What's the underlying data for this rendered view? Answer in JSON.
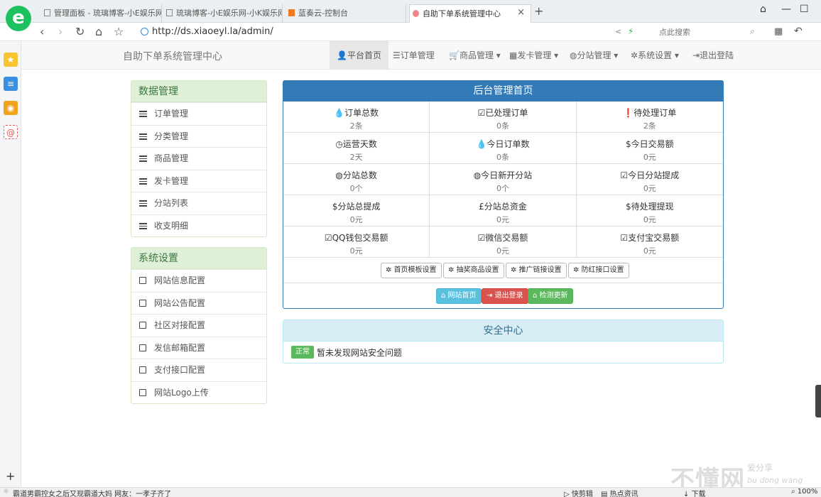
{
  "browser": {
    "tabs": [
      {
        "title": "管理面板 - 琉璃博客-小E娱乐网"
      },
      {
        "title": "琉璃博客-小E娱乐网-小K娱乐网"
      },
      {
        "title": "蓝奏云-控制台"
      },
      {
        "title": "自助下单系统管理中心"
      }
    ],
    "url": "http://ds.xiaoeyl.la/admin/",
    "search_placeholder": "点此搜索",
    "logo_letter": "e"
  },
  "nav": {
    "brand": "自助下单系统管理中心",
    "items": [
      {
        "label": "平台首页",
        "icon": "user-icon",
        "glyph": "👤"
      },
      {
        "label": "订单管理",
        "icon": "list-icon",
        "glyph": "☰"
      },
      {
        "label": "商品管理 ▾",
        "icon": "cart-icon",
        "glyph": "🛒"
      },
      {
        "label": "发卡管理 ▾",
        "icon": "grid-icon",
        "glyph": "▦"
      },
      {
        "label": "分站管理 ▾",
        "icon": "globe-icon",
        "glyph": "◍"
      },
      {
        "label": "系统设置 ▾",
        "icon": "gear-icon",
        "glyph": "✲"
      },
      {
        "label": "退出登陆",
        "icon": "logout-icon",
        "glyph": "⇥"
      }
    ]
  },
  "sidebar": {
    "data_title": "数据管理",
    "data_items": [
      "订单管理",
      "分类管理",
      "商品管理",
      "发卡管理",
      "分站列表",
      "收支明细"
    ],
    "system_title": "系统设置",
    "system_items": [
      "网站信息配置",
      "网站公告配置",
      "社区对接配置",
      "发信邮箱配置",
      "支付接口配置",
      "网站Logo上传"
    ]
  },
  "dashboard": {
    "title": "后台管理首页",
    "stats": [
      {
        "icon": "💧",
        "label": "订单总数",
        "value": "2条"
      },
      {
        "icon": "☑",
        "label": "已处理订单",
        "value": "0条"
      },
      {
        "icon": "❗",
        "label": "待处理订单",
        "value": "2条"
      },
      {
        "icon": "◷",
        "label": "运营天数",
        "value": "2天"
      },
      {
        "icon": "💧",
        "label": "今日订单数",
        "value": "0条"
      },
      {
        "icon": "$",
        "label": "今日交易额",
        "value": "0元"
      },
      {
        "icon": "◍",
        "label": "分站总数",
        "value": "0个"
      },
      {
        "icon": "◍",
        "label": "今日新开分站",
        "value": "0个"
      },
      {
        "icon": "☑",
        "label": "今日分站提成",
        "value": "0元"
      },
      {
        "icon": "$",
        "label": "分站总提成",
        "value": "0元"
      },
      {
        "icon": "£",
        "label": "分站总资金",
        "value": "0元"
      },
      {
        "icon": "$",
        "label": "待处理提现",
        "value": "0元"
      },
      {
        "icon": "☑",
        "label": "QQ钱包交易额",
        "value": "0元"
      },
      {
        "icon": "☑",
        "label": "微信交易额",
        "value": "0元"
      },
      {
        "icon": "☑",
        "label": "支付宝交易额",
        "value": "0元"
      }
    ],
    "setting_buttons": [
      "首页模板设置",
      "抽奖商品设置",
      "推广链接设置",
      "防红接口设置"
    ],
    "action_buttons": [
      {
        "label": "网站首页",
        "style": "info"
      },
      {
        "label": "退出登录",
        "style": "danger"
      },
      {
        "label": "检测更新",
        "style": "success"
      }
    ]
  },
  "security": {
    "title": "安全中心",
    "badge": "正常",
    "message": "暂未发现网站安全问题"
  },
  "statusbar": {
    "news": "霸道男霸控女之后又现霸道大妈 网友：一孝子齐了",
    "items": [
      "快剪辑",
      "热点资讯",
      "下载",
      "100%"
    ]
  },
  "watermark": {
    "main": "不懂网",
    "sub": "爱分享",
    "pinyin": "bu dong wang"
  }
}
